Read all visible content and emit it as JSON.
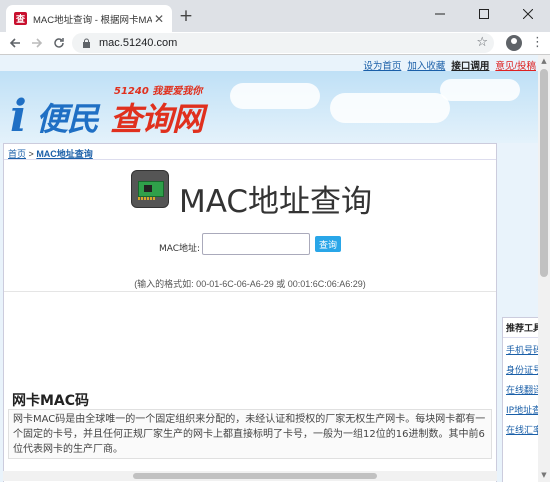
{
  "browser": {
    "tab_title": "MAC地址查询 - 根据网卡MAC地",
    "tab_favicon": "查",
    "url": "mac.51240.com"
  },
  "top_links": [
    "设为首页",
    "加入收藏",
    "接口调用",
    "意见/投稿"
  ],
  "logo": {
    "letter": "i",
    "name_part1": "便民",
    "name_part2": "查询网",
    "slogan": "51240 我要爱我你"
  },
  "breadcrumb": {
    "home": "首页",
    "separator": ">",
    "current": "MAC地址查询"
  },
  "page_title": "MAC地址查询",
  "form": {
    "label": "MAC地址:",
    "input_value": "",
    "button": "查询",
    "hint": "(输入的格式如: 00-01-6C-06-A6-29 或 00:01:6C:06:A6:29)"
  },
  "section": {
    "title": "网卡MAC码",
    "description": "网卡MAC码是由全球唯一的一个固定组织来分配的，未经认证和授权的厂家无权生产网卡。每块网卡都有一个固定的卡号，并且任何正规厂家生产的网卡上都直接标明了卡号，一般为一组12位的16进制数。其中前6位代表网卡的生产厂商。"
  },
  "sidebar": {
    "title": "推荐工具",
    "links": [
      "手机号码",
      "身份证号",
      "在线翻译",
      "IP地址查",
      "在线汇率"
    ]
  },
  "colors": {
    "accent": "#29a6e8",
    "link": "#1a5fa8",
    "logo_blue": "#1f6fc4",
    "logo_red": "#e0301e"
  }
}
